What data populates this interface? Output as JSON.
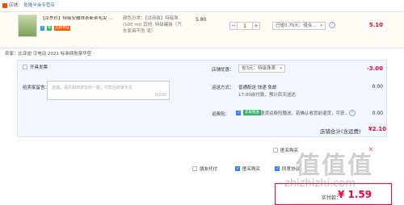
{
  "shop": {
    "label": "店铺：",
    "name": "乾隆半亩专营店"
  },
  "product": {
    "title": "【京东价】特级安徽珠茶新茶毛尖 ...",
    "tags": [
      {
        "text": "7",
        "color": "#2ea4e7"
      },
      {
        "text": "赠",
        "color": "#33b36b"
      },
      {
        "text": "品质保证",
        "color": "#ff5500"
      }
    ],
    "specs": "颜色分类：【试用装】特级珠(100 ml) 其他: 特级罐装（汽车家具不伤 漆）",
    "unit_price": "5.80",
    "quantity": "1",
    "discount_select": "已省0.70元：组合...",
    "subtotal": "5.10"
  },
  "promo_line": "卖家：比亚迪 汉电动 2021 标准续航豪华型",
  "open_invoice_label": "开具发票",
  "message": {
    "label": "给卖家留言：",
    "placeholder": "选填，请先和商家协商一致，付款后商家可见",
    "counter": "0/200"
  },
  "shop_discount": {
    "label": "店铺优惠：",
    "select": "省3元：特级珠茶",
    "amount": "-3.00"
  },
  "shipping": {
    "label": "运送方式：",
    "method": "普通配送 快递 免邮",
    "note": "17:00前付款，预计后天送达",
    "cost": "0.00"
  },
  "insurance": {
    "label": "运费险：",
    "badge": "卖家赠送",
    "text": "退货运费险赠送，若确认收货前退货，可获...",
    "cost": "0.00"
  },
  "shop_total": {
    "label": "店铺合计(含运费)",
    "amount": "¥2.10"
  },
  "summary": {
    "anon_label": "匿名购买",
    "friend_pay_label": "朋友代付",
    "option1_label": "匿名购买",
    "option2_label": "同意协议",
    "actual_pay_label": "实付款：",
    "actual_pay_amount": "¥ 1.59"
  },
  "watermark": {
    "main": "值值值",
    "url": "zhizhizhi.com"
  }
}
